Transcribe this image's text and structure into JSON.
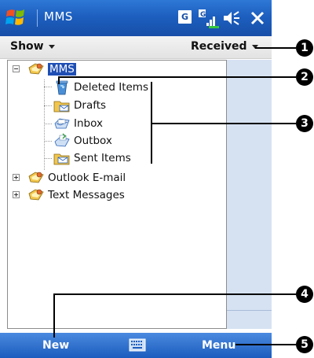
{
  "titlebar": {
    "app_title": "MMS",
    "status_g": "G"
  },
  "menubar": {
    "show_label": "Show",
    "received_label": "Received"
  },
  "tree": {
    "root": {
      "label": "MMS"
    },
    "children": [
      {
        "label": "Deleted Items",
        "icon": "deleted-items-icon"
      },
      {
        "label": "Drafts",
        "icon": "drafts-folder-icon"
      },
      {
        "label": "Inbox",
        "icon": "inbox-icon"
      },
      {
        "label": "Outbox",
        "icon": "outbox-icon"
      },
      {
        "label": "Sent Items",
        "icon": "sent-items-icon"
      }
    ],
    "accounts": [
      {
        "label": "Outlook E-mail"
      },
      {
        "label": "Text Messages"
      }
    ]
  },
  "bottombar": {
    "new_label": "New",
    "menu_label": "Menu"
  },
  "callouts": [
    "1",
    "2",
    "3",
    "4",
    "5"
  ],
  "colors": {
    "titlebar": "#1d5fbf",
    "selection": "#1f4fb5",
    "side_strip": "#d6e2f2"
  }
}
